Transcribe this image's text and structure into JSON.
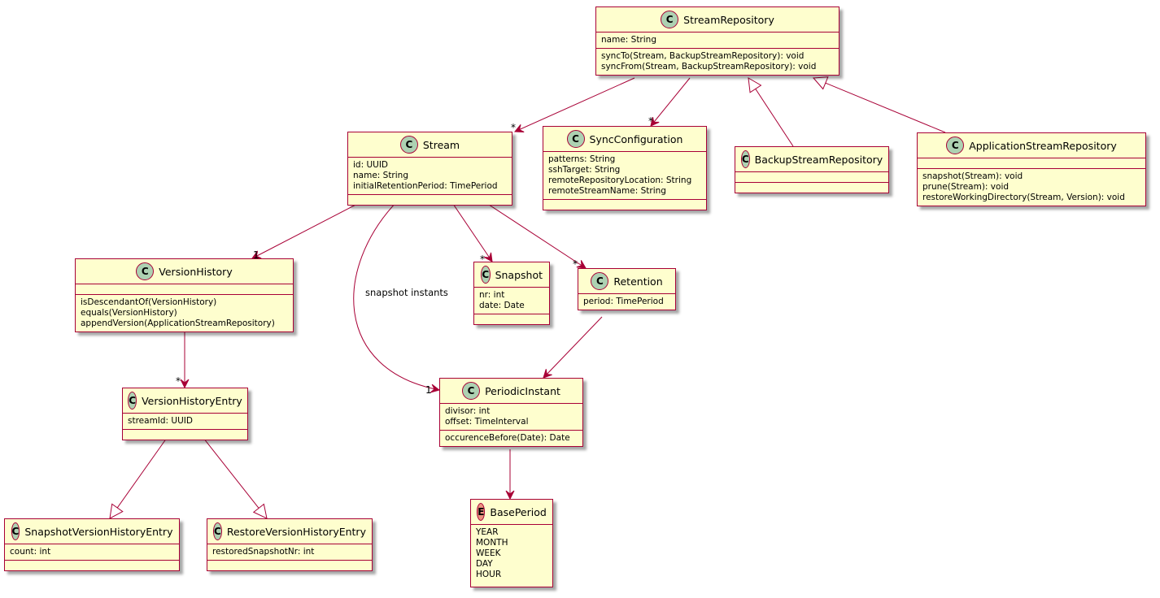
{
  "colors": {
    "fill": "#FEFECE",
    "border": "#A80036",
    "class_icon": "#ADD1B2",
    "enum_icon": "#EB937F",
    "edge": "#A80036"
  },
  "classes": [
    {
      "id": "StreamRepository",
      "name": "StreamRepository",
      "kind": "C",
      "fields": [
        "name: String"
      ],
      "methods": [
        "syncTo(Stream, BackupStreamRepository): void",
        "syncFrom(Stream, BackupStreamRepository): void"
      ]
    },
    {
      "id": "Stream",
      "name": "Stream",
      "kind": "C",
      "fields": [
        "id: UUID",
        "name: String",
        "initialRetentionPeriod: TimePeriod"
      ],
      "methods": []
    },
    {
      "id": "SyncConfiguration",
      "name": "SyncConfiguration",
      "kind": "C",
      "fields": [
        "patterns: String",
        "sshTarget: String",
        "remoteRepositoryLocation: String",
        "remoteStreamName: String"
      ],
      "methods": []
    },
    {
      "id": "BackupStreamRepository",
      "name": "BackupStreamRepository",
      "kind": "C",
      "fields": [],
      "methods": []
    },
    {
      "id": "ApplicationStreamRepository",
      "name": "ApplicationStreamRepository",
      "kind": "C",
      "fields": [],
      "methods": [
        "snapshot(Stream): void",
        "prune(Stream): void",
        "restoreWorkingDirectory(Stream, Version): void"
      ]
    },
    {
      "id": "VersionHistory",
      "name": "VersionHistory",
      "kind": "C",
      "fields": [],
      "methods": [
        "isDescendantOf(VersionHistory)",
        "equals(VersionHistory)",
        "appendVersion(ApplicationStreamRepository)"
      ]
    },
    {
      "id": "Snapshot",
      "name": "Snapshot",
      "kind": "C",
      "fields": [
        "nr: int",
        "date: Date"
      ],
      "methods": []
    },
    {
      "id": "Retention",
      "name": "Retention",
      "kind": "C",
      "fields": [
        "period: TimePeriod"
      ],
      "methods": null
    },
    {
      "id": "VersionHistoryEntry",
      "name": "VersionHistoryEntry",
      "kind": "C",
      "fields": [
        "streamId: UUID"
      ],
      "methods": []
    },
    {
      "id": "PeriodicInstant",
      "name": "PeriodicInstant",
      "kind": "C",
      "fields": [
        "divisor: int",
        "offset: TimeInterval"
      ],
      "methods": [
        "occurenceBefore(Date): Date"
      ]
    },
    {
      "id": "BasePeriod",
      "name": "BasePeriod",
      "kind": "E",
      "fields": [
        "YEAR",
        "MONTH",
        "WEEK",
        "DAY",
        "HOUR"
      ],
      "methods": null
    },
    {
      "id": "SnapshotVersionHistoryEntry",
      "name": "SnapshotVersionHistoryEntry",
      "kind": "C",
      "fields": [
        "count: int"
      ],
      "methods": []
    },
    {
      "id": "RestoreVersionHistoryEntry",
      "name": "RestoreVersionHistoryEntry",
      "kind": "C",
      "fields": [
        "restoredSnapshotNr: int"
      ],
      "methods": []
    }
  ],
  "relations": [
    {
      "from": "StreamRepository",
      "to": "Stream",
      "type": "association",
      "multiplicity": "*"
    },
    {
      "from": "StreamRepository",
      "to": "SyncConfiguration",
      "type": "association",
      "multiplicity": "*"
    },
    {
      "from": "BackupStreamRepository",
      "to": "StreamRepository",
      "type": "inheritance"
    },
    {
      "from": "ApplicationStreamRepository",
      "to": "StreamRepository",
      "type": "inheritance"
    },
    {
      "from": "Stream",
      "to": "VersionHistory",
      "type": "association",
      "multiplicity": "1"
    },
    {
      "from": "Stream",
      "to": "PeriodicInstant",
      "type": "association",
      "multiplicity": "1",
      "label": "snapshot instants"
    },
    {
      "from": "Stream",
      "to": "Snapshot",
      "type": "association",
      "multiplicity": "*"
    },
    {
      "from": "Stream",
      "to": "Retention",
      "type": "association",
      "multiplicity": "*"
    },
    {
      "from": "VersionHistory",
      "to": "VersionHistoryEntry",
      "type": "association",
      "multiplicity": "*"
    },
    {
      "from": "Retention",
      "to": "PeriodicInstant",
      "type": "association"
    },
    {
      "from": "PeriodicInstant",
      "to": "BasePeriod",
      "type": "association"
    },
    {
      "from": "VersionHistoryEntry",
      "to": "SnapshotVersionHistoryEntry",
      "type": "inheritance"
    },
    {
      "from": "VersionHistoryEntry",
      "to": "RestoreVersionHistoryEntry",
      "type": "inheritance"
    }
  ]
}
